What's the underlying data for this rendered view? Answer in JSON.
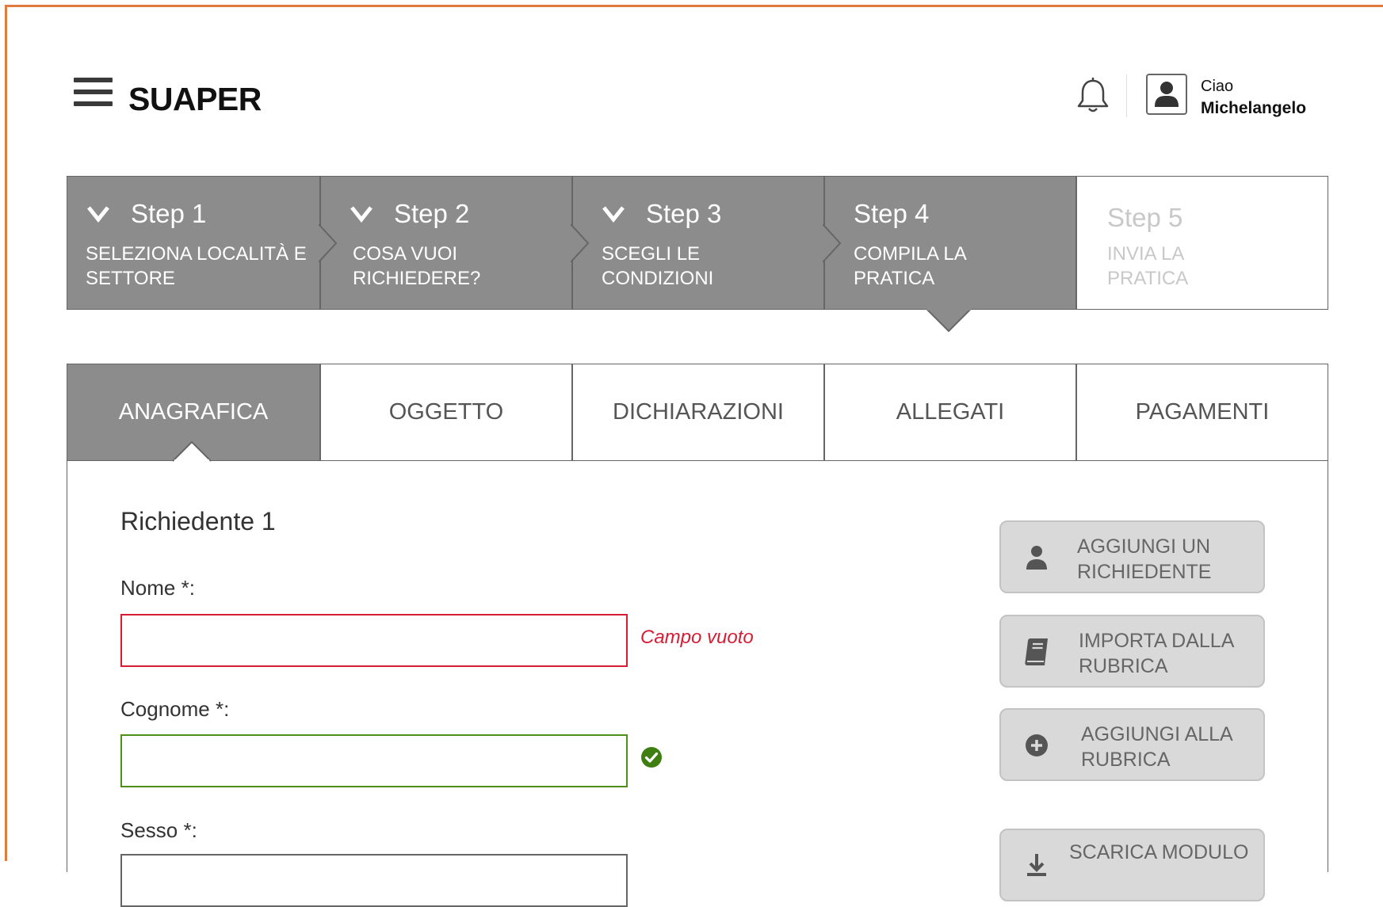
{
  "header": {
    "app_name": "SUAPER",
    "greeting": "Ciao",
    "user_name": "Michelangelo"
  },
  "stepper": {
    "steps": [
      {
        "title": "Step 1",
        "description": "SELEZIONA LOCALITÀ E SETTORE",
        "status": "completed"
      },
      {
        "title": "Step 2",
        "description": "COSA VUOI RICHIEDERE?",
        "status": "completed"
      },
      {
        "title": "Step 3",
        "description": "SCEGLI LE CONDIZIONI",
        "status": "completed"
      },
      {
        "title": "Step 4",
        "description": "COMPILA LA PRATICA",
        "status": "active"
      },
      {
        "title": "Step 5",
        "description": "INVIA LA PRATICA",
        "status": "pending"
      }
    ]
  },
  "tabs": {
    "items": [
      "ANAGRAFICA",
      "OGGETTO",
      "DICHIARAZIONI",
      "ALLEGATI",
      "PAGAMENTI"
    ],
    "active": "ANAGRAFICA"
  },
  "form": {
    "section_title": "Richiedente 1",
    "fields": [
      {
        "label": "Nome *:",
        "value": "",
        "state": "error",
        "message": "Campo vuoto"
      },
      {
        "label": "Cognome *:",
        "value": "",
        "state": "valid"
      },
      {
        "label": "Sesso *:",
        "value": ""
      }
    ]
  },
  "actions": {
    "buttons": [
      {
        "label": "AGGIUNGI UN RICHIEDENTE",
        "icon": "user-icon"
      },
      {
        "label": "IMPORTA DALLA RUBRICA",
        "icon": "book-icon"
      },
      {
        "label": "AGGIUNGI ALLA RUBRICA",
        "icon": "plus-circle-icon"
      },
      {
        "label": "SCARICA MODULO",
        "icon": "download-icon"
      }
    ]
  },
  "colors": {
    "accent_border": "#e07b3f",
    "step_active_bg": "#8c8c8c",
    "error": "#d61d34",
    "valid": "#4e8f1a"
  }
}
